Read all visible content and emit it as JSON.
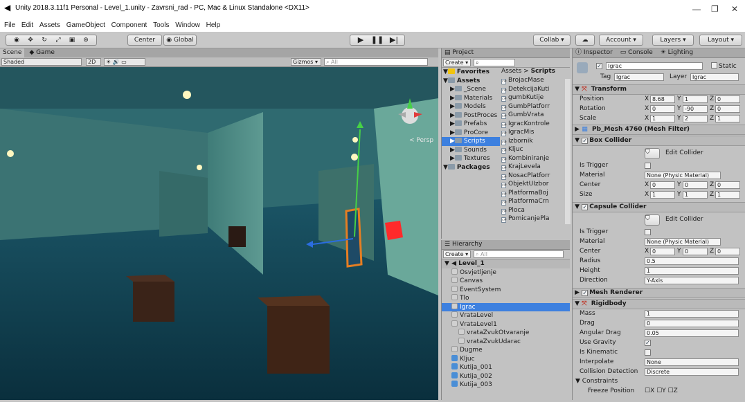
{
  "window": {
    "title": "Unity 2018.3.11f1 Personal - Level_1.unity - Zavrsni_rad - PC, Mac & Linux Standalone <DX11>"
  },
  "menu": [
    "File",
    "Edit",
    "Assets",
    "GameObject",
    "Component",
    "Tools",
    "Window",
    "Help"
  ],
  "toolbar": {
    "pivot": "Center",
    "space": "Global",
    "collab": "Collab ▾",
    "account": "Account",
    "layers": "Layers",
    "layout": "Layout"
  },
  "scene": {
    "tab_scene": "Scene",
    "tab_game": "Game",
    "shading": "Shaded",
    "mode_2d": "2D",
    "gizmos": "Gizmos",
    "search_placeholder": "All",
    "persp": "< Persp"
  },
  "project": {
    "title": "Project",
    "create": "Create",
    "path_root": "Assets",
    "path_leaf": "Scripts",
    "tree": [
      {
        "label": "Favorites",
        "kind": "fav"
      },
      {
        "label": "Assets",
        "kind": "root"
      },
      {
        "label": "_Scene"
      },
      {
        "label": "Materials"
      },
      {
        "label": "Models"
      },
      {
        "label": "PostProces"
      },
      {
        "label": "Prefabs"
      },
      {
        "label": "ProCore"
      },
      {
        "label": "Scripts",
        "selected": true
      },
      {
        "label": "Sounds"
      },
      {
        "label": "Textures"
      },
      {
        "label": "Packages",
        "kind": "root"
      }
    ],
    "files": [
      "BrojacMase",
      "DetekcijaKuti",
      "gumbKutije",
      "GumbPlatforr",
      "GumbVrata",
      "IgracKontrole",
      "IgracMis",
      "Izbornik",
      "Kljuc",
      "Kombiniranje",
      "KrajLevela",
      "NosacPlatforr",
      "ObjektUIzbor",
      "PlatformaBoj",
      "PlatformaCrn",
      "Ploca",
      "PomicanjePla"
    ]
  },
  "hierarchy": {
    "title": "Hierarchy",
    "create": "Create",
    "search_placeholder": "All",
    "scene_name": "Level_1",
    "items": [
      {
        "label": "Osvjetljenje",
        "indent": 1,
        "kind": "go"
      },
      {
        "label": "Canvas",
        "indent": 1,
        "kind": "go"
      },
      {
        "label": "EventSystem",
        "indent": 1,
        "kind": "go"
      },
      {
        "label": "Tlo",
        "indent": 1,
        "kind": "go"
      },
      {
        "label": "Igrac",
        "indent": 1,
        "kind": "go",
        "selected": true
      },
      {
        "label": "VrataLevel",
        "indent": 1,
        "kind": "go"
      },
      {
        "label": "VrataLevel1",
        "indent": 1,
        "kind": "go"
      },
      {
        "label": "vrataZvukOtvaranje",
        "indent": 2,
        "kind": "go"
      },
      {
        "label": "vrataZvukUdarac",
        "indent": 2,
        "kind": "go"
      },
      {
        "label": "Dugme",
        "indent": 1,
        "kind": "go"
      },
      {
        "label": "Kljuc",
        "indent": 1,
        "kind": "pf"
      },
      {
        "label": "Kutija_001",
        "indent": 1,
        "kind": "pf"
      },
      {
        "label": "Kutija_002",
        "indent": 1,
        "kind": "pf"
      },
      {
        "label": "Kutija_003",
        "indent": 1,
        "kind": "pf"
      }
    ]
  },
  "inspector": {
    "tab_inspector": "Inspector",
    "tab_console": "Console",
    "tab_lighting": "Lighting",
    "name": "Igrac",
    "static": "Static",
    "tag_label": "Tag",
    "tag_value": "Igrac",
    "layer_label": "Layer",
    "layer_value": "Igrac",
    "transform": {
      "title": "Transform",
      "position_label": "Position",
      "position": [
        "8.68",
        "1",
        "0"
      ],
      "rotation_label": "Rotation",
      "rotation": [
        "0",
        "-90",
        "0"
      ],
      "scale_label": "Scale",
      "scale": [
        "1",
        "2",
        "1"
      ]
    },
    "mesh_filter": "Pb_Mesh 4760 (Mesh Filter)",
    "box_collider": {
      "title": "Box Collider",
      "edit": "Edit Collider",
      "is_trigger": "Is Trigger",
      "material_label": "Material",
      "material": "None (Physic Material)",
      "center_label": "Center",
      "center": [
        "0",
        "0",
        "0"
      ],
      "size_label": "Size",
      "size": [
        "1",
        "1",
        "1"
      ]
    },
    "capsule_collider": {
      "title": "Capsule Collider",
      "edit": "Edit Collider",
      "is_trigger": "Is Trigger",
      "material_label": "Material",
      "material": "None (Physic Material)",
      "center_label": "Center",
      "center": [
        "0",
        "0",
        "0"
      ],
      "radius_label": "Radius",
      "radius": "0.5",
      "height_label": "Height",
      "height": "1",
      "direction_label": "Direction",
      "direction": "Y-Axis"
    },
    "mesh_renderer": "Mesh Renderer",
    "rigidbody": {
      "title": "Rigidbody",
      "mass_label": "Mass",
      "mass": "1",
      "drag_label": "Drag",
      "drag": "0",
      "angular_drag_label": "Angular Drag",
      "angular_drag": "0.05",
      "use_gravity_label": "Use Gravity",
      "is_kinematic_label": "Is Kinematic",
      "interpolate_label": "Interpolate",
      "interpolate": "None",
      "collision_label": "Collision Detection",
      "collision": "Discrete",
      "constraints_label": "Constraints",
      "freeze_label": "Freeze Position"
    }
  },
  "colors": {
    "selection": "#3d80df",
    "editor_bg": "#c2c2c2",
    "scene_floor": "#0e3a4a"
  }
}
